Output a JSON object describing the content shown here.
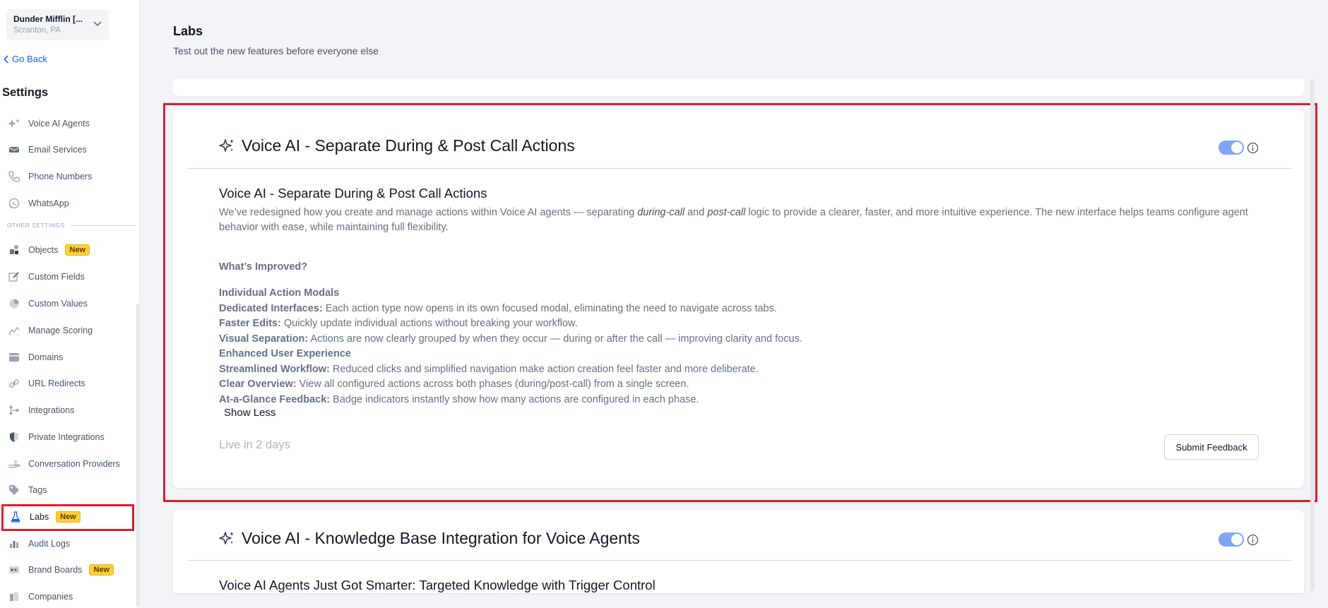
{
  "account": {
    "name": "Dunder Mifflin [...",
    "location": "Scranton, PA"
  },
  "sidebar": {
    "go_back": "Go Back",
    "title": "Settings",
    "section_label": "OTHER SETTINGS",
    "items": [
      {
        "label": "Voice AI Agents",
        "icon": "sparkle-icon"
      },
      {
        "label": "Email Services",
        "icon": "envelope-icon"
      },
      {
        "label": "Phone Numbers",
        "icon": "phone-icon"
      },
      {
        "label": "WhatsApp",
        "icon": "whatsapp-icon"
      },
      {
        "label": "Objects",
        "icon": "shapes-icon",
        "badge": "New"
      },
      {
        "label": "Custom Fields",
        "icon": "edit-icon"
      },
      {
        "label": "Custom Values",
        "icon": "pie-icon"
      },
      {
        "label": "Manage Scoring",
        "icon": "chart-icon"
      },
      {
        "label": "Domains",
        "icon": "globe-icon"
      },
      {
        "label": "URL Redirects",
        "icon": "link-icon"
      },
      {
        "label": "Integrations",
        "icon": "integrations-icon"
      },
      {
        "label": "Private Integrations",
        "icon": "shield-icon"
      },
      {
        "label": "Conversation Providers",
        "icon": "hand-icon"
      },
      {
        "label": "Tags",
        "icon": "tag-icon"
      },
      {
        "label": "Labs",
        "icon": "flask-icon",
        "badge": "New",
        "active": true
      },
      {
        "label": "Audit Logs",
        "icon": "bar-chart-icon"
      },
      {
        "label": "Brand Boards",
        "icon": "palette-icon",
        "badge": "New"
      },
      {
        "label": "Companies",
        "icon": "building-icon"
      }
    ]
  },
  "header": {
    "title": "Labs",
    "subtitle": "Test out the new features before everyone else"
  },
  "features": [
    {
      "header": "Voice AI - Separate During & Post Call Actions",
      "title": "Voice AI - Separate During & Post Call Actions",
      "desc_part1": "We’ve redesigned how you create and manage actions within Voice AI agents — separating ",
      "desc_em1": "during-call",
      "desc_and": " and ",
      "desc_em2": "post-call",
      "desc_part2": " logic to provide a clearer, faster, and more intuitive experience. The new interface helps teams configure agent behavior with ease, while maintaining full flexibility.",
      "improved_heading": "What’s Improved?",
      "details": [
        {
          "heading": "Individual Action Modals"
        },
        {
          "label": "Dedicated Interfaces:",
          "text": " Each action type now opens in its own focused modal, eliminating the need to navigate across tabs."
        },
        {
          "label": "Faster Edits:",
          "text": " Quickly update individual actions without breaking your workflow."
        },
        {
          "label": "Visual Separation:",
          "text": " Actions are now clearly grouped by when they occur — during or after the call — improving clarity and focus."
        },
        {
          "heading": "Enhanced User Experience"
        },
        {
          "label": "Streamlined Workflow:",
          "text": " Reduced clicks and simplified navigation make action creation feel faster and more deliberate."
        },
        {
          "label": "Clear Overview:",
          "text": " View all configured actions across both phases (during/post-call) from a single screen."
        },
        {
          "label": "At-a-Glance Feedback:",
          "text": " Badge indicators instantly show how many actions are configured in each phase."
        }
      ],
      "show_less": "Show Less",
      "live_in": "Live in 2 days",
      "submit": "Submit Feedback",
      "enabled": true
    },
    {
      "header": "Voice AI - Knowledge Base Integration for Voice Agents",
      "title": "Voice AI Agents Just Got Smarter: Targeted Knowledge with Trigger Control",
      "enabled": true
    }
  ],
  "colors": {
    "accent": "#155eef",
    "toggle": "#7ea6f4",
    "highlight": "#d62030",
    "badge": "#fdcf3b"
  }
}
